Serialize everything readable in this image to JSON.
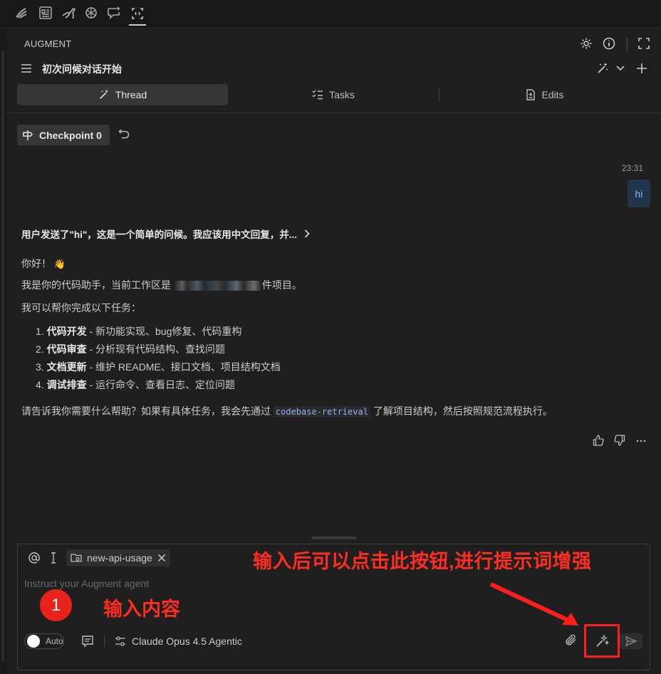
{
  "header": {
    "section_label": "AUGMENT",
    "conversation_title": "初次问候对话开始"
  },
  "tabs": [
    {
      "label": "Thread",
      "active": true
    },
    {
      "label": "Tasks",
      "active": false
    },
    {
      "label": "Edits",
      "active": false
    }
  ],
  "checkpoint": {
    "label": "Checkpoint 0"
  },
  "user_message": {
    "time": "23:31",
    "text": "hi"
  },
  "assistant": {
    "thinking_summary": "用户发送了\"hi\"，这是一个简单的问候。我应该用中文回复，并...",
    "greeting": "你好！",
    "greeting_emoji": "👋",
    "workspace_prefix": "我是你的代码助手，当前工作区是",
    "workspace_suffix": "件项目。",
    "intro": "我可以帮你完成以下任务：",
    "tasks": [
      {
        "num": "1.",
        "title": "代码开发",
        "desc": " - 新功能实现、bug修复、代码重构"
      },
      {
        "num": "2.",
        "title": "代码审查",
        "desc": " - 分析现有代码结构、查找问题"
      },
      {
        "num": "3.",
        "title": "文档更新",
        "desc": " - 维护 README、接口文档、项目结构文档"
      },
      {
        "num": "4.",
        "title": "调试排查",
        "desc": " - 运行命令、查看日志、定位问题"
      }
    ],
    "closing_prefix": "请告诉我你需要什么帮助？如果有具体任务，我会先通过",
    "closing_code": "codebase-retrieval",
    "closing_suffix": "了解项目结构，然后按照规范流程执行。"
  },
  "input": {
    "context_chip": "new-api-usage",
    "placeholder": "Instruct your Augment agent",
    "auto_label": "Auto",
    "model": "Claude Opus 4.5 Agentic"
  },
  "annotations": {
    "step_number": "1",
    "input_hint": "输入内容",
    "enhance_hint": "输入后可以点击此按钮,进行提示词增强",
    "color": "#ff2d20"
  }
}
